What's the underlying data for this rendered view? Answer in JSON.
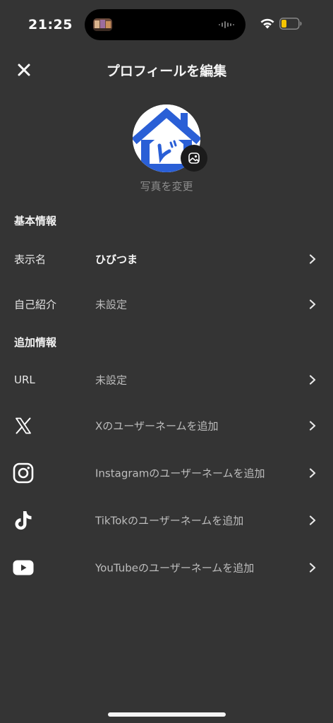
{
  "status_bar": {
    "time": "21:25",
    "battery_color": "#f5c400"
  },
  "header": {
    "title": "プロフィールを編集",
    "close_icon": "close-icon"
  },
  "profile": {
    "avatar_icon": "house-logo",
    "change_photo_label": "写真を変更",
    "brand_color": "#2a5fd6"
  },
  "basic_info": {
    "section_title": "基本情報",
    "rows": [
      {
        "label": "表示名",
        "value": "ひびつま"
      },
      {
        "label": "自己紹介",
        "value": "未設定"
      }
    ]
  },
  "additional_info": {
    "section_title": "追加情報",
    "url_row": {
      "label": "URL",
      "value": "未設定"
    },
    "social_rows": [
      {
        "icon": "x-logo-icon",
        "value": "Xのユーザーネームを追加"
      },
      {
        "icon": "instagram-icon",
        "value": "Instagramのユーザーネームを追加"
      },
      {
        "icon": "tiktok-icon",
        "value": "TikTokのユーザーネームを追加"
      },
      {
        "icon": "youtube-icon",
        "value": "YouTubeのユーザーネームを追加"
      }
    ]
  }
}
